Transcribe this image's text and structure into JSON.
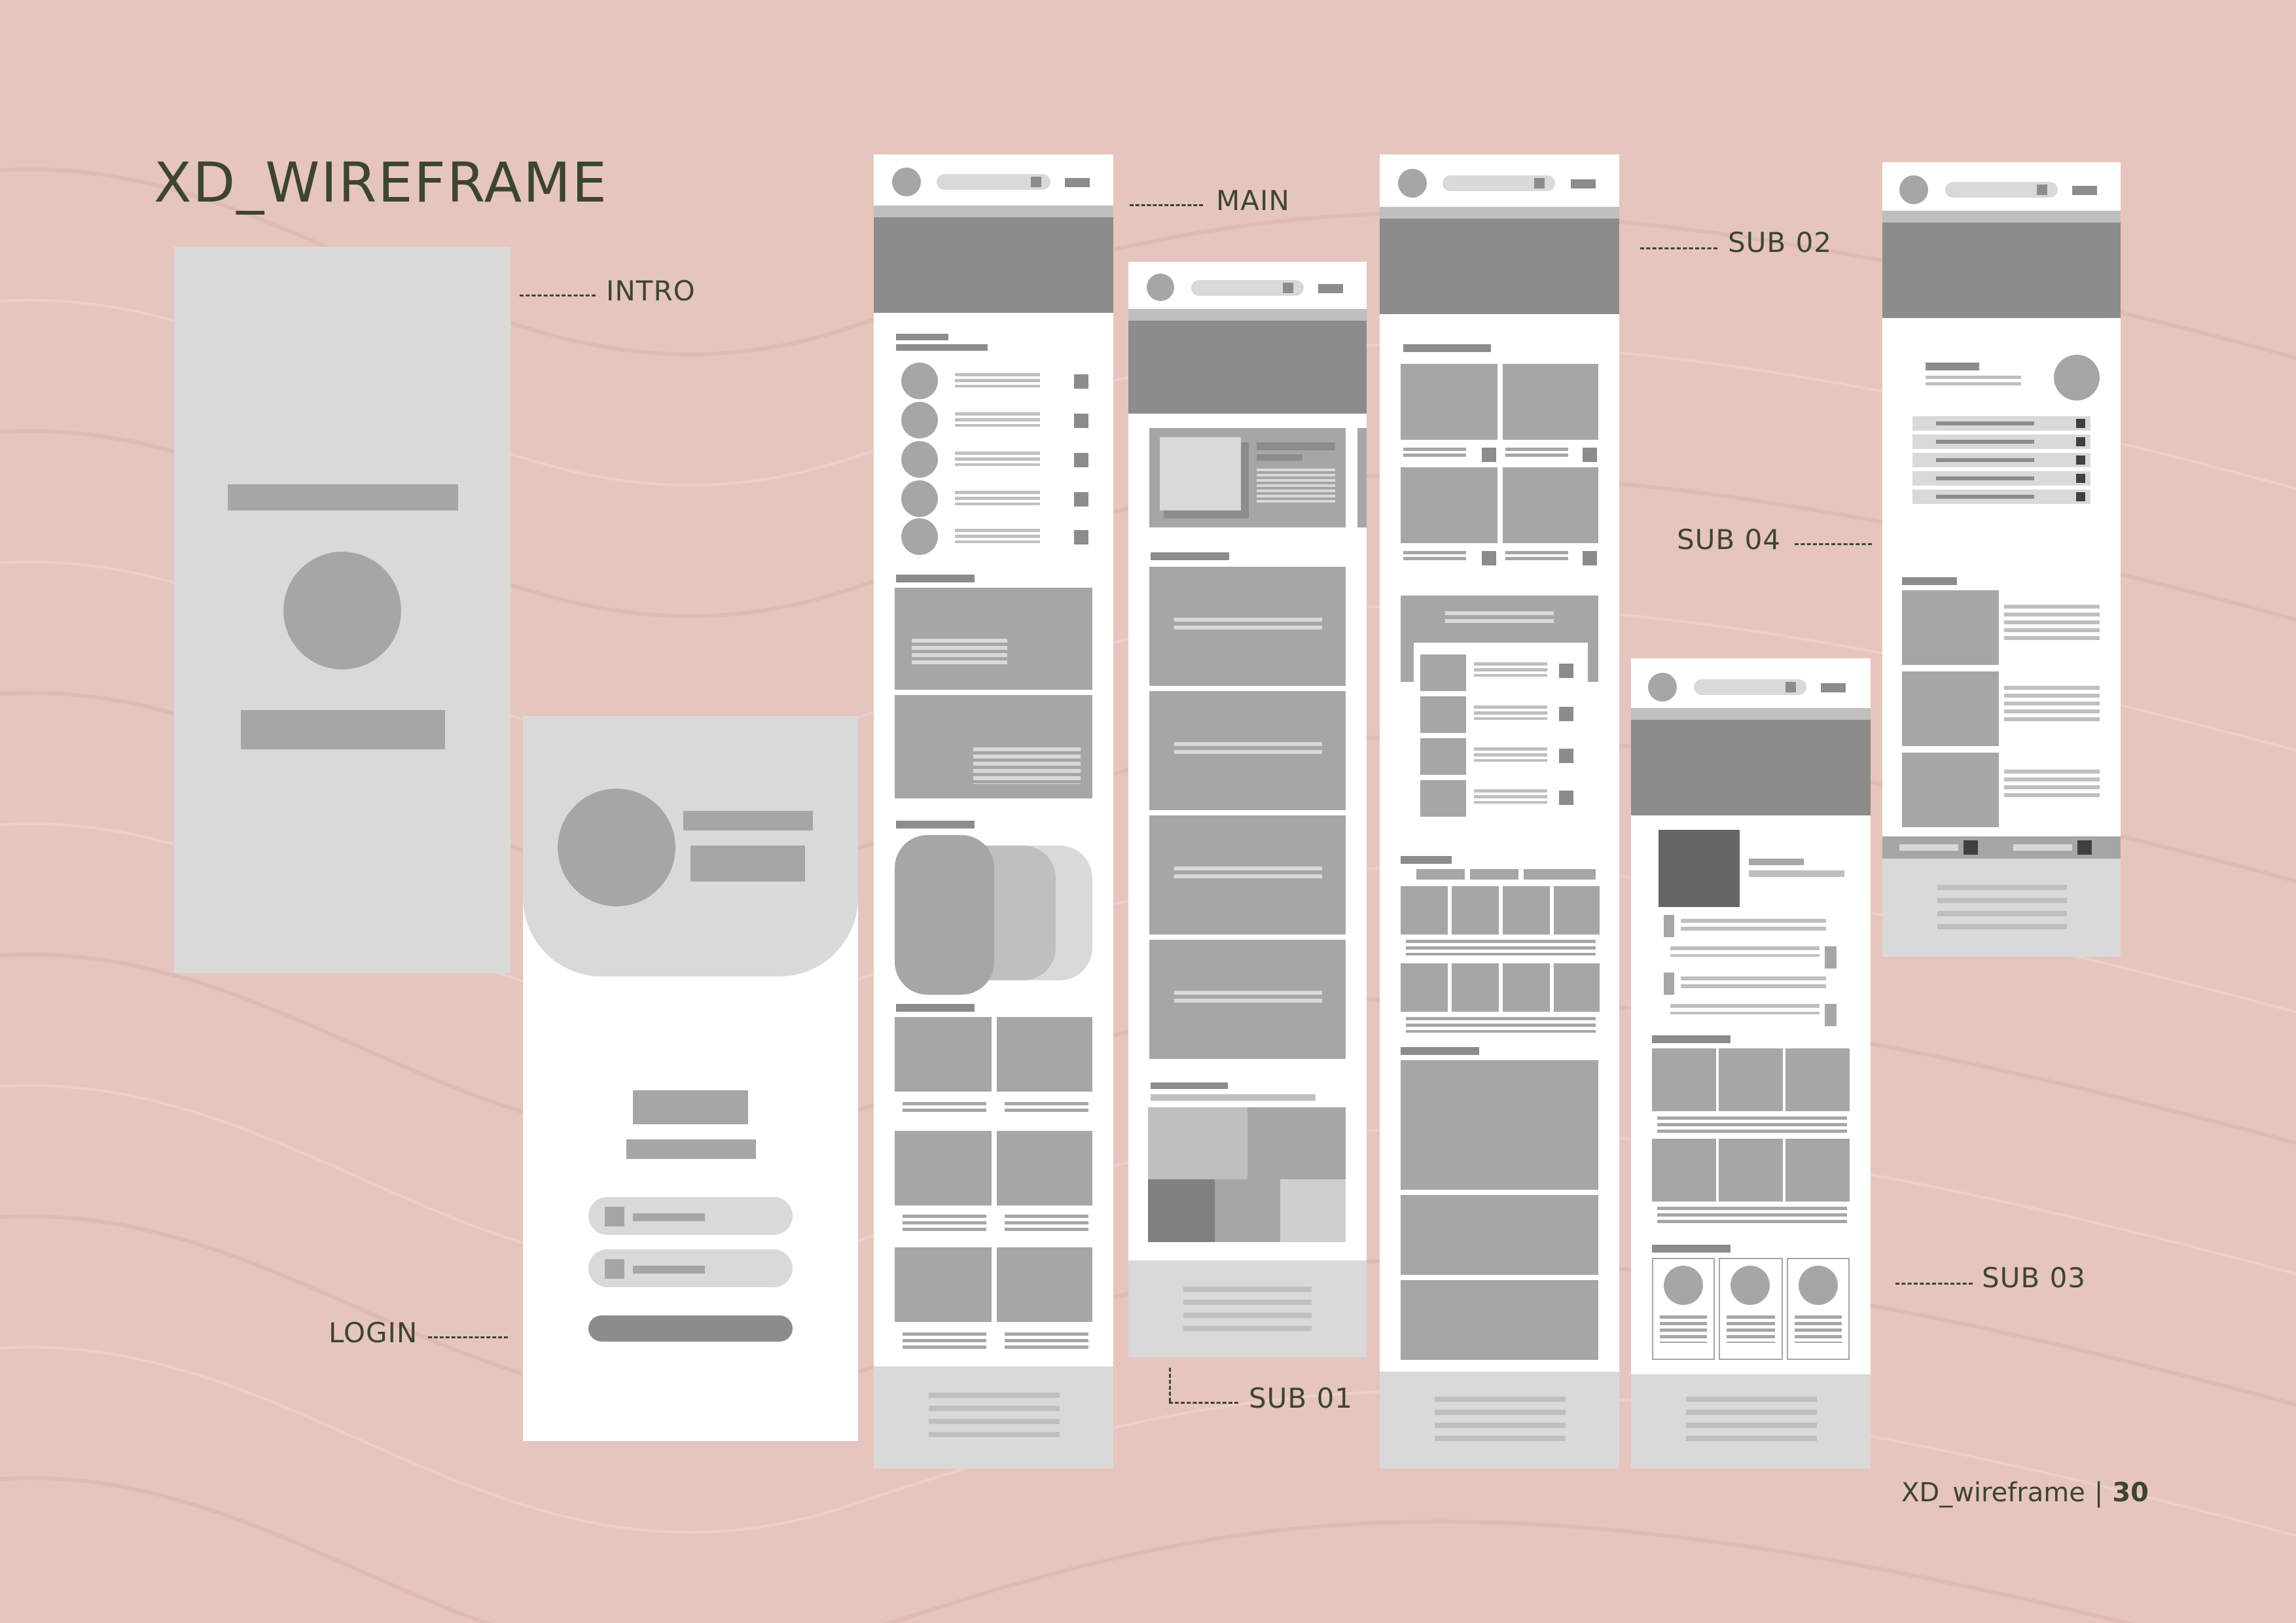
{
  "title": "XD_WIREFRAME",
  "labels": {
    "intro": "INTRO",
    "login": "LOGIN",
    "main": "MAIN",
    "sub01": "SUB 01",
    "sub02": "SUB 02",
    "sub03": "SUB 03",
    "sub04": "SUB 04"
  },
  "footer": {
    "doc": "XD_wireframe",
    "page": "30"
  },
  "colors": {
    "background": "#e6c5bf",
    "text": "#3c4530",
    "screen": "#ffffff",
    "block_light": "#d9d9d9",
    "block_mid": "#a6a6a6",
    "block_dark": "#8c8c8c"
  }
}
